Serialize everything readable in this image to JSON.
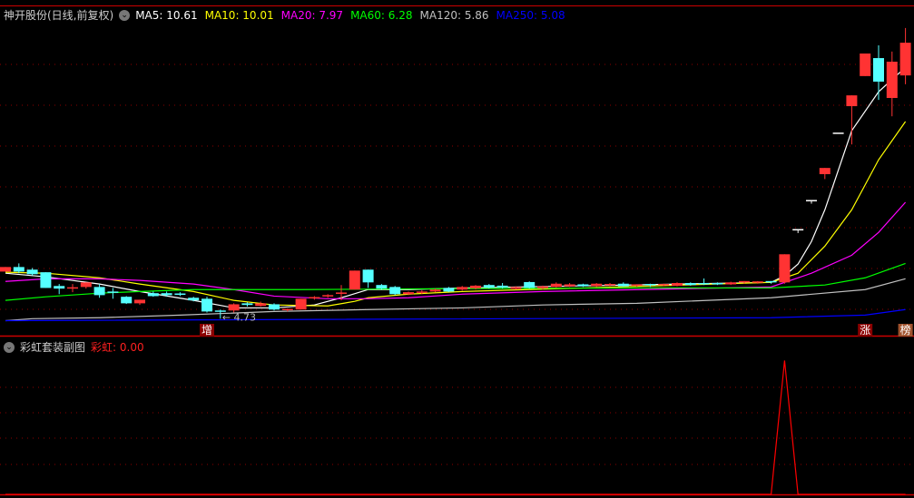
{
  "main_panel": {
    "title": "神开股份(日线,前复权)",
    "ma_labels": [
      {
        "text": "MA5: 10.61",
        "color": "#ffffff"
      },
      {
        "text": "MA10: 10.01",
        "color": "#ffff00"
      },
      {
        "text": "MA20: 7.97",
        "color": "#ff00ff"
      },
      {
        "text": "MA60: 6.28",
        "color": "#00ff00"
      },
      {
        "text": "MA120: 5.86",
        "color": "#c0c0c0"
      },
      {
        "text": "MA250: 5.08",
        "color": "#0000ff"
      }
    ],
    "low_label": "4.73",
    "markers": [
      {
        "text": "增",
        "index": 15,
        "bg": "#8b0000"
      },
      {
        "text": "涨",
        "index": 64,
        "bg": "#8b0000"
      },
      {
        "text": "榜",
        "index": 67,
        "bg": "#a0522d"
      }
    ]
  },
  "sub_panel": {
    "title": "彩虹套装副图",
    "value_label": "彩虹: 0.00"
  },
  "colors": {
    "up": "#ff3333",
    "down": "#55ffff",
    "doji": "#ffffff",
    "grid": "#8b0000",
    "separator": "#cc0000"
  },
  "chart_data": [
    {
      "type": "candlestick",
      "title": "神开股份(日线,前复权)",
      "ylim": [
        4.6,
        13.7
      ],
      "candles_ohlc": [
        [
          6.17,
          6.31,
          6.17,
          6.31
        ],
        [
          6.31,
          6.42,
          6.12,
          6.17
        ],
        [
          6.23,
          6.28,
          6.05,
          6.09
        ],
        [
          6.15,
          6.15,
          5.67,
          5.67
        ],
        [
          5.73,
          5.79,
          5.48,
          5.65
        ],
        [
          5.65,
          5.79,
          5.54,
          5.67
        ],
        [
          5.7,
          5.84,
          5.65,
          5.84
        ],
        [
          5.7,
          5.79,
          5.37,
          5.45
        ],
        [
          5.54,
          5.67,
          5.34,
          5.52
        ],
        [
          5.4,
          5.42,
          5.18,
          5.2
        ],
        [
          5.2,
          5.31,
          5.15,
          5.31
        ],
        [
          5.51,
          5.56,
          5.4,
          5.42
        ],
        [
          5.51,
          5.56,
          5.4,
          5.45
        ],
        [
          5.48,
          5.54,
          5.42,
          5.47
        ],
        [
          5.37,
          5.4,
          5.26,
          5.29
        ],
        [
          5.34,
          5.4,
          4.92,
          4.95
        ],
        [
          4.96,
          5.01,
          4.73,
          4.95
        ],
        [
          4.98,
          5.2,
          4.92,
          5.17
        ],
        [
          5.2,
          5.23,
          5.1,
          5.15
        ],
        [
          5.12,
          5.25,
          5.1,
          5.2
        ],
        [
          5.17,
          5.2,
          4.98,
          5.01
        ],
        [
          4.98,
          5.04,
          4.95,
          5.01
        ],
        [
          5.01,
          5.34,
          5.01,
          5.34
        ],
        [
          5.36,
          5.42,
          5.31,
          5.37
        ],
        [
          5.42,
          5.48,
          5.37,
          5.43
        ],
        [
          5.5,
          5.76,
          5.29,
          5.51
        ],
        [
          5.62,
          6.2,
          5.62,
          6.2
        ],
        [
          6.23,
          6.23,
          5.67,
          5.84
        ],
        [
          5.76,
          5.79,
          5.62,
          5.65
        ],
        [
          5.7,
          5.73,
          5.45,
          5.48
        ],
        [
          5.48,
          5.56,
          5.45,
          5.54
        ],
        [
          5.53,
          5.6,
          5.48,
          5.54
        ],
        [
          5.56,
          5.65,
          5.54,
          5.62
        ],
        [
          5.67,
          5.7,
          5.54,
          5.56
        ],
        [
          5.62,
          5.73,
          5.59,
          5.7
        ],
        [
          5.66,
          5.76,
          5.62,
          5.74
        ],
        [
          5.76,
          5.79,
          5.65,
          5.68
        ],
        [
          5.74,
          5.82,
          5.65,
          5.68
        ],
        [
          5.64,
          5.72,
          5.62,
          5.7
        ],
        [
          5.85,
          5.87,
          5.65,
          5.67
        ],
        [
          5.66,
          5.74,
          5.62,
          5.72
        ],
        [
          5.7,
          5.84,
          5.68,
          5.8
        ],
        [
          5.72,
          5.82,
          5.7,
          5.78
        ],
        [
          5.78,
          5.8,
          5.7,
          5.72
        ],
        [
          5.73,
          5.82,
          5.7,
          5.8
        ],
        [
          5.76,
          5.82,
          5.72,
          5.77
        ],
        [
          5.8,
          5.84,
          5.7,
          5.72
        ],
        [
          5.72,
          5.78,
          5.7,
          5.76
        ],
        [
          5.77,
          5.8,
          5.7,
          5.73
        ],
        [
          5.76,
          5.8,
          5.72,
          5.77
        ],
        [
          5.74,
          5.84,
          5.72,
          5.82
        ],
        [
          5.82,
          5.84,
          5.74,
          5.76
        ],
        [
          5.8,
          5.96,
          5.76,
          5.78
        ],
        [
          5.8,
          5.84,
          5.76,
          5.79
        ],
        [
          5.78,
          5.86,
          5.76,
          5.84
        ],
        [
          5.82,
          5.88,
          5.8,
          5.86
        ],
        [
          5.84,
          5.88,
          5.8,
          5.85
        ],
        [
          5.86,
          5.88,
          5.8,
          5.82
        ],
        [
          5.84,
          6.7,
          5.8,
          6.7
        ],
        [
          7.45,
          7.45,
          7.35,
          7.45
        ],
        [
          8.34,
          8.34,
          8.25,
          8.34
        ],
        [
          9.15,
          9.34,
          9.0,
          9.34
        ],
        [
          10.4,
          10.4,
          10.4,
          10.4
        ],
        [
          11.23,
          11.56,
          10.06,
          11.56
        ],
        [
          12.15,
          12.84,
          12.15,
          12.84
        ],
        [
          12.7,
          13.09,
          11.42,
          11.98
        ],
        [
          11.48,
          12.9,
          10.92,
          12.59
        ],
        [
          12.17,
          13.62,
          11.9,
          13.17
        ]
      ],
      "low_point": {
        "index": 16,
        "value": 4.73
      },
      "series": [
        {
          "name": "MA5",
          "color": "#ffffff",
          "points": [
            [
              0,
              6.12
            ],
            [
              3,
              6.01
            ],
            [
              7,
              5.79
            ],
            [
              10,
              5.56
            ],
            [
              14,
              5.29
            ],
            [
              17,
              5.06
            ],
            [
              20,
              5.06
            ],
            [
              23,
              5.15
            ],
            [
              25,
              5.37
            ],
            [
              27,
              5.62
            ],
            [
              30,
              5.62
            ],
            [
              34,
              5.67
            ],
            [
              45,
              5.75
            ],
            [
              57,
              5.84
            ],
            [
              58,
              6.04
            ],
            [
              59,
              6.4
            ],
            [
              60,
              7.09
            ],
            [
              61,
              8.06
            ],
            [
              63,
              10.48
            ],
            [
              65,
              11.67
            ],
            [
              67,
              12.42
            ]
          ]
        },
        {
          "name": "MA10",
          "color": "#ffff00",
          "points": [
            [
              0,
              6.15
            ],
            [
              3,
              6.12
            ],
            [
              7,
              5.98
            ],
            [
              10,
              5.79
            ],
            [
              14,
              5.56
            ],
            [
              17,
              5.29
            ],
            [
              20,
              5.15
            ],
            [
              24,
              5.12
            ],
            [
              26,
              5.26
            ],
            [
              27,
              5.37
            ],
            [
              30,
              5.48
            ],
            [
              34,
              5.56
            ],
            [
              57,
              5.84
            ],
            [
              59,
              6.12
            ],
            [
              61,
              6.95
            ],
            [
              63,
              8.06
            ],
            [
              65,
              9.59
            ],
            [
              67,
              10.76
            ]
          ]
        },
        {
          "name": "MA20",
          "color": "#ff00ff",
          "points": [
            [
              0,
              5.87
            ],
            [
              3,
              5.95
            ],
            [
              7,
              5.95
            ],
            [
              10,
              5.9
            ],
            [
              14,
              5.79
            ],
            [
              17,
              5.62
            ],
            [
              20,
              5.42
            ],
            [
              24,
              5.34
            ],
            [
              27,
              5.34
            ],
            [
              30,
              5.37
            ],
            [
              34,
              5.48
            ],
            [
              40,
              5.56
            ],
            [
              57,
              5.7
            ],
            [
              60,
              6.12
            ],
            [
              63,
              6.67
            ],
            [
              65,
              7.37
            ],
            [
              67,
              8.29
            ]
          ]
        },
        {
          "name": "MA60",
          "color": "#00ff00",
          "points": [
            [
              0,
              5.29
            ],
            [
              3,
              5.4
            ],
            [
              7,
              5.51
            ],
            [
              10,
              5.56
            ],
            [
              14,
              5.62
            ],
            [
              17,
              5.62
            ],
            [
              22,
              5.62
            ],
            [
              34,
              5.65
            ],
            [
              47,
              5.67
            ],
            [
              57,
              5.67
            ],
            [
              61,
              5.76
            ],
            [
              64,
              5.98
            ],
            [
              67,
              6.42
            ]
          ]
        },
        {
          "name": "MA120",
          "color": "#c0c0c0",
          "points": [
            [
              0,
              4.67
            ],
            [
              2,
              4.73
            ],
            [
              7,
              4.76
            ],
            [
              13,
              4.84
            ],
            [
              20,
              4.95
            ],
            [
              27,
              5.01
            ],
            [
              34,
              5.06
            ],
            [
              40,
              5.15
            ],
            [
              47,
              5.2
            ],
            [
              57,
              5.37
            ],
            [
              64,
              5.62
            ],
            [
              67,
              5.95
            ]
          ]
        },
        {
          "name": "MA250",
          "color": "#0000ff",
          "points": [
            [
              0,
              4.67
            ],
            [
              57,
              4.76
            ],
            [
              64,
              4.84
            ],
            [
              67,
              5.01
            ]
          ]
        }
      ]
    },
    {
      "type": "line",
      "title": "彩虹套装副图",
      "ylim": [
        0,
        105
      ],
      "series": [
        {
          "name": "彩虹",
          "color": "#ff0000",
          "points": [
            [
              0,
              0
            ],
            [
              57,
              0
            ],
            [
              58,
              100
            ],
            [
              59,
              0
            ],
            [
              67,
              0
            ]
          ]
        }
      ]
    }
  ]
}
